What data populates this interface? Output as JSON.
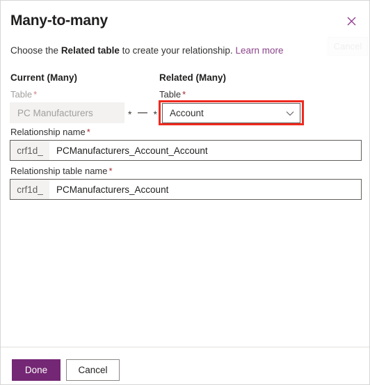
{
  "dialog": {
    "title": "Many-to-many",
    "close_icon": "close-icon"
  },
  "subtitle": {
    "prefix": "Choose the ",
    "bold": "Related table",
    "suffix": " to create your relationship. ",
    "link": "Learn more"
  },
  "ghost": {
    "cancel_label": "Cancel"
  },
  "columns": {
    "current_heading": "Current (Many)",
    "related_heading": "Related (Many)"
  },
  "current_table": {
    "label": "Table",
    "required_mark": "*",
    "value": "PC Manufacturers",
    "disabled": true
  },
  "cardinality": {
    "left": "*",
    "right": "*"
  },
  "related_table": {
    "label": "Table",
    "required_mark": "*",
    "value": "Account",
    "chevron_icon": "chevron-down-icon",
    "highlight_color": "#f0291f"
  },
  "relationship_name": {
    "label": "Relationship name",
    "required_mark": "*",
    "prefix": "crf1d_",
    "value": "PCManufacturers_Account_Account"
  },
  "relationship_table_name": {
    "label": "Relationship table name",
    "required_mark": "*",
    "prefix": "crf1d_",
    "value": "PCManufacturers_Account"
  },
  "footer": {
    "done_label": "Done",
    "cancel_label": "Cancel",
    "accent_color": "#742774"
  }
}
